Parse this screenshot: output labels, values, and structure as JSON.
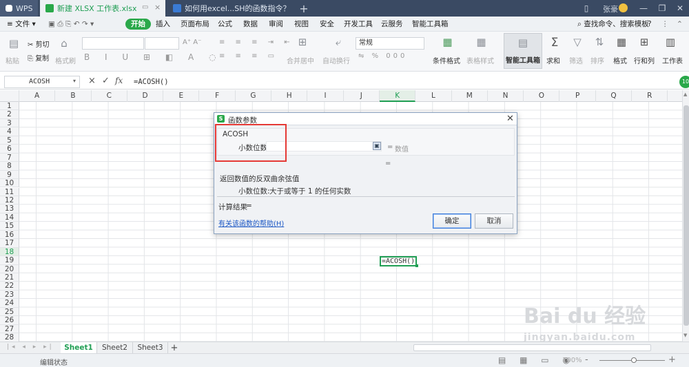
{
  "titlebar": {
    "app_label": "WPS",
    "tabs": [
      {
        "label": "新建 XLSX 工作表.xlsx",
        "active": true
      },
      {
        "label": "如何用excel...SH的函数指令？",
        "active": false
      }
    ],
    "new_tab": "+",
    "user": "张豪"
  },
  "menu": {
    "file": "文件",
    "start": "开始",
    "items": [
      "插入",
      "页面布局",
      "公式",
      "数据",
      "审阅",
      "视图",
      "安全",
      "开发工具",
      "云服务",
      "智能工具箱"
    ],
    "search": "查找命令、搜索模板",
    "help": "?"
  },
  "ribbon": {
    "paste": "粘贴",
    "cut": "剪切",
    "copy": "复制",
    "format_painter": "格式刷",
    "merge": "合并居中",
    "wrap": "自动换行",
    "number_format": "常规",
    "cond_format": "条件格式",
    "table_style": "表格样式",
    "smart_toolbox": "智能工具箱",
    "sum": "求和",
    "filter": "筛选",
    "sort": "排序",
    "format": "格式",
    "rowcol": "行和列",
    "sheet": "工作表",
    "percent": "%",
    "thousands": "000"
  },
  "formula": {
    "namebox": "ACOSH",
    "cancel": "×",
    "confirm": "✓",
    "fx": "fx",
    "value": "=ACOSH()"
  },
  "grid": {
    "columns": [
      "A",
      "B",
      "C",
      "D",
      "E",
      "F",
      "G",
      "H",
      "I",
      "J",
      "K",
      "L",
      "M",
      "N",
      "O",
      "P",
      "Q",
      "R"
    ],
    "rows": [
      "1",
      "2",
      "3",
      "4",
      "5",
      "6",
      "7",
      "8",
      "9",
      "10",
      "11",
      "12",
      "13",
      "14",
      "15",
      "16",
      "17",
      "18",
      "19",
      "20",
      "21",
      "22",
      "23",
      "24",
      "25",
      "26",
      "27",
      "28"
    ],
    "active_col": "K",
    "active_row": "18",
    "active_cell_value": "=ACOSH()"
  },
  "dialog": {
    "title": "函数参数",
    "func_name": "ACOSH",
    "arg_label": "小数位数",
    "arg_value": "",
    "eq1": "=",
    "hint": "数值",
    "eq2": "=",
    "description": "返回数值的反双曲余弦值",
    "arg_desc_label": "小数位数:",
    "arg_desc": "大于或等于 1 的任何实数",
    "result_label": "计算结果",
    "result_eq": "=",
    "help_link": "有关该函数的帮助(H)",
    "ok": "确定",
    "cancel": "取消"
  },
  "sheets": [
    "Sheet1",
    "Sheet2",
    "Sheet3"
  ],
  "add_sheet": "+",
  "status": {
    "mode": "编辑状态",
    "zoom": "100%",
    "zoom_minus": "-",
    "zoom_plus": "+"
  },
  "watermark": {
    "brand": "Bai du 经验",
    "url": "jingyan.baidu.com"
  },
  "colors": {
    "accent": "#1f9e53",
    "titlebar": "#3a4a63",
    "highlight": "#e53935",
    "link": "#1a56c4"
  }
}
